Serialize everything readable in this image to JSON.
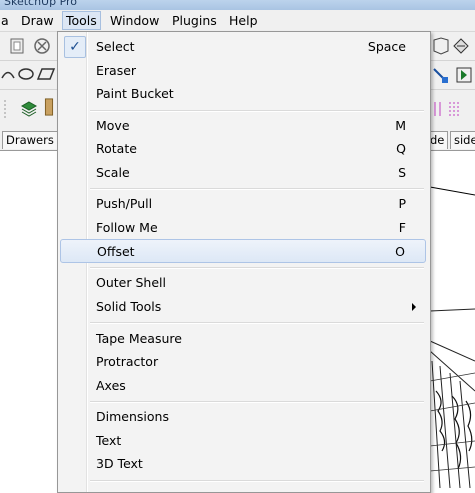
{
  "window": {
    "title": "SketchUp Pro"
  },
  "menubar": {
    "items": [
      {
        "label": "a"
      },
      {
        "label": "Draw"
      },
      {
        "label": "Tools"
      },
      {
        "label": "Window"
      },
      {
        "label": "Plugins"
      },
      {
        "label": "Help"
      }
    ]
  },
  "tabs": [
    {
      "label": "Drawers"
    },
    {
      "label": "de"
    },
    {
      "label": "side"
    }
  ],
  "tools_menu": {
    "items": [
      {
        "label": "Select",
        "shortcut": "Space",
        "checked": true
      },
      {
        "label": "Eraser",
        "shortcut": ""
      },
      {
        "label": "Paint Bucket",
        "shortcut": ""
      },
      {
        "label": "Move",
        "shortcut": "M"
      },
      {
        "label": "Rotate",
        "shortcut": "Q"
      },
      {
        "label": "Scale",
        "shortcut": "S"
      },
      {
        "label": "Push/Pull",
        "shortcut": "P"
      },
      {
        "label": "Follow Me",
        "shortcut": "F"
      },
      {
        "label": "Offset",
        "shortcut": "O",
        "highlighted": true
      },
      {
        "label": "Outer Shell",
        "shortcut": ""
      },
      {
        "label": "Solid Tools",
        "shortcut": "",
        "submenu": true
      },
      {
        "label": "Tape Measure",
        "shortcut": ""
      },
      {
        "label": "Protractor",
        "shortcut": ""
      },
      {
        "label": "Axes",
        "shortcut": ""
      },
      {
        "label": "Dimensions",
        "shortcut": ""
      },
      {
        "label": "Text",
        "shortcut": ""
      },
      {
        "label": "3D Text",
        "shortcut": ""
      }
    ]
  },
  "colors": {
    "menu_bg": "#f3f3f3",
    "highlight": "#dde8f6",
    "highlight_border": "#adc4e6",
    "titlebar": "#bcd3ec"
  }
}
